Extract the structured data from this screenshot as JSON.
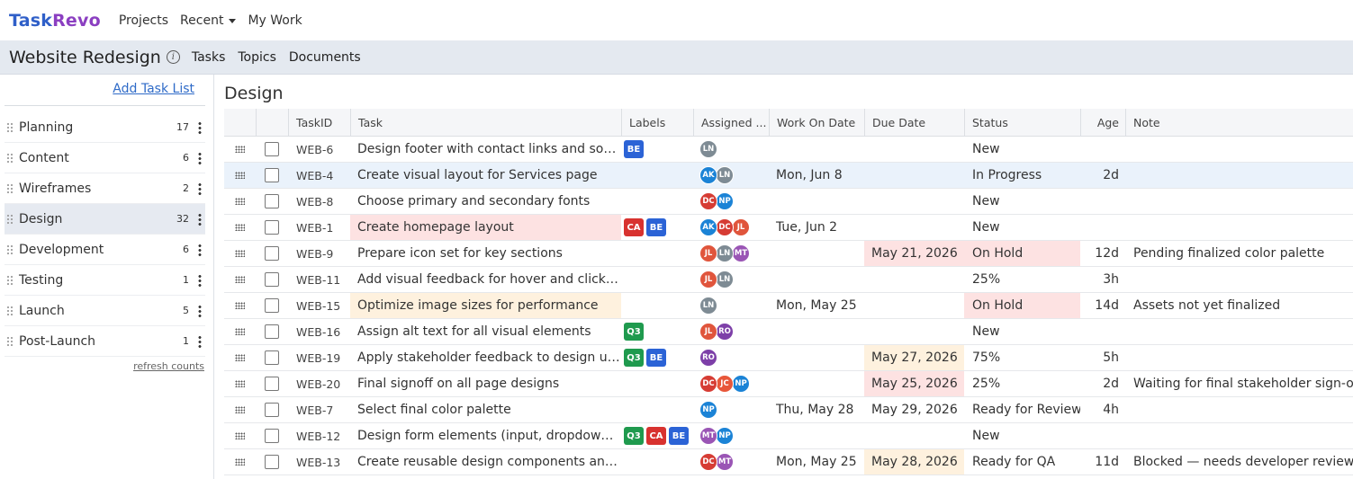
{
  "brand": {
    "part1": "Task",
    "part2": "Revo"
  },
  "topnav": {
    "projects": "Projects",
    "recent": "Recent",
    "my_work": "My Work"
  },
  "project": {
    "title": "Website Redesign",
    "info_icon": "i",
    "tabs": [
      "Tasks",
      "Topics",
      "Documents"
    ]
  },
  "sidebar": {
    "add_task_list": "Add Task List",
    "refresh_counts": "refresh counts",
    "lists": [
      {
        "name": "Planning",
        "count": "17"
      },
      {
        "name": "Content",
        "count": "6"
      },
      {
        "name": "Wireframes",
        "count": "2"
      },
      {
        "name": "Design",
        "count": "32"
      },
      {
        "name": "Development",
        "count": "6"
      },
      {
        "name": "Testing",
        "count": "1"
      },
      {
        "name": "Launch",
        "count": "5"
      },
      {
        "name": "Post-Launch",
        "count": "1"
      }
    ],
    "active_index": 3
  },
  "main": {
    "title": "Design",
    "columns": [
      "TaskID",
      "Task",
      "Labels",
      "Assigned ...",
      "Work On Date",
      "Due Date",
      "Status",
      "Age",
      "Note"
    ]
  },
  "colors": {
    "label_BE": "#2b63d6",
    "label_CA": "#d8322f",
    "label_Q3": "#1f9a4e",
    "LN": "#7e8b94",
    "AK": "#1b83d6",
    "DC": "#d63c34",
    "NP": "#1b83d6",
    "JL": "#e0553c",
    "MT": "#9a55b5",
    "RO": "#7d3fa8",
    "JC": "#e8573a"
  },
  "tasks": [
    {
      "id": "WEB-6",
      "task": "Design footer with contact links and social icons",
      "labels": [
        "BE"
      ],
      "assigned": [
        "LN"
      ],
      "work_on": "",
      "due": "",
      "status": "New",
      "age": "",
      "note": ""
    },
    {
      "id": "WEB-4",
      "task": "Create visual layout for Services page",
      "labels": [],
      "assigned": [
        "AK",
        "LN"
      ],
      "work_on": "Mon, Jun 8",
      "due": "",
      "status": "In Progress",
      "age": "2d",
      "note": "",
      "selected": true
    },
    {
      "id": "WEB-8",
      "task": "Choose primary and secondary fonts",
      "labels": [],
      "assigned": [
        "DC",
        "NP"
      ],
      "work_on": "",
      "due": "",
      "status": "New",
      "age": "",
      "note": ""
    },
    {
      "id": "WEB-1",
      "task": "Create homepage layout",
      "labels": [
        "CA",
        "BE"
      ],
      "assigned": [
        "AK",
        "DC",
        "JL"
      ],
      "work_on": "Tue, Jun 2",
      "due": "",
      "status": "New",
      "age": "",
      "note": "",
      "task_hl": "red"
    },
    {
      "id": "WEB-9",
      "task": "Prepare icon set for key sections",
      "labels": [],
      "assigned": [
        "JL",
        "LN",
        "MT"
      ],
      "work_on": "",
      "due": "May 21, 2026",
      "status": "On Hold",
      "age": "12d",
      "note": "Pending finalized color palette",
      "due_hl": "red",
      "status_hl": "red"
    },
    {
      "id": "WEB-11",
      "task": "Add visual feedback for hover and click states",
      "labels": [],
      "assigned": [
        "JL",
        "LN"
      ],
      "work_on": "",
      "due": "",
      "status": "25%",
      "age": "3h",
      "note": ""
    },
    {
      "id": "WEB-15",
      "task": "Optimize image sizes for performance",
      "labels": [],
      "assigned": [
        "LN"
      ],
      "work_on": "Mon, May 25",
      "due": "",
      "status": "On Hold",
      "age": "14d",
      "note": "Assets not yet finalized",
      "task_hl": "orange",
      "status_hl": "red"
    },
    {
      "id": "WEB-16",
      "task": "Assign alt text for all visual elements",
      "labels": [
        "Q3"
      ],
      "assigned": [
        "JL",
        "RO"
      ],
      "work_on": "",
      "due": "",
      "status": "New",
      "age": "",
      "note": ""
    },
    {
      "id": "WEB-19",
      "task": "Apply stakeholder feedback to design updates",
      "labels": [
        "Q3",
        "BE"
      ],
      "assigned": [
        "RO"
      ],
      "work_on": "",
      "due": "May 27, 2026",
      "status": "75%",
      "age": "5h",
      "note": "",
      "due_hl": "orange"
    },
    {
      "id": "WEB-20",
      "task": "Final signoff on all page designs",
      "labels": [],
      "assigned": [
        "DC",
        "JC",
        "NP"
      ],
      "work_on": "",
      "due": "May 25, 2026",
      "status": "25%",
      "age": "2d",
      "note": "Waiting for final stakeholder sign-off",
      "due_hl": "red"
    },
    {
      "id": "WEB-7",
      "task": "Select final color palette",
      "labels": [],
      "assigned": [
        "NP"
      ],
      "work_on": "Thu, May 28",
      "due": "May 29, 2026",
      "status": "Ready for Review",
      "age": "4h",
      "note": ""
    },
    {
      "id": "WEB-12",
      "task": "Design form elements (input, dropdown, buttons)",
      "labels": [
        "Q3",
        "CA",
        "BE"
      ],
      "assigned": [
        "MT",
        "NP"
      ],
      "work_on": "",
      "due": "",
      "status": "New",
      "age": "",
      "note": ""
    },
    {
      "id": "WEB-13",
      "task": "Create reusable design components and templates",
      "labels": [],
      "assigned": [
        "DC",
        "MT"
      ],
      "work_on": "Mon, May 25",
      "due": "May 28, 2026",
      "status": "Ready for QA",
      "age": "11d",
      "note": "Blocked — needs developer review",
      "due_hl": "orange"
    }
  ]
}
